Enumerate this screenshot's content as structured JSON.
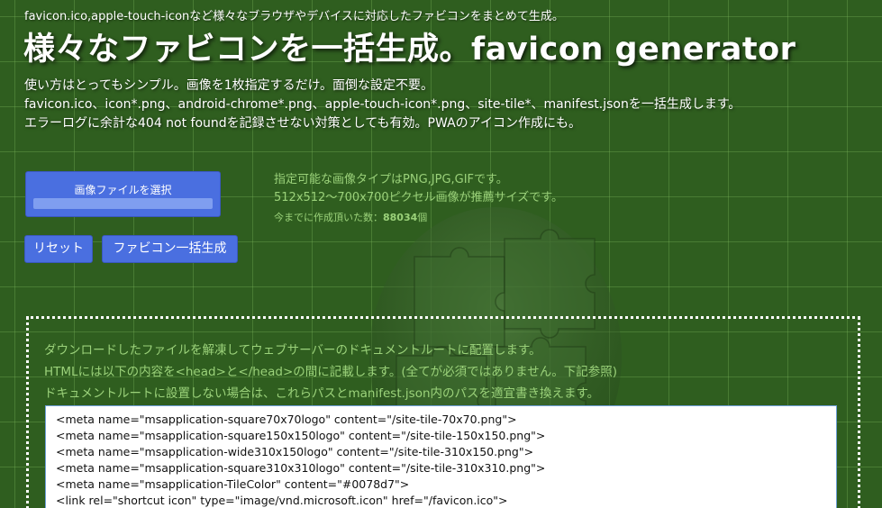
{
  "header": {
    "tagline": "favicon.ico,apple-touch-iconなど様々なブラウザやデバイスに対応したファビコンをまとめて生成。",
    "title": "様々なファビコンを一括生成。favicon generator"
  },
  "intro": {
    "lines": [
      "使い方はとってもシンプル。画像を1枚指定するだけ。面倒な設定不要。",
      "favicon.ico、icon*.png、android-chrome*.png、apple-touch-icon*.png、site-tile*、manifest.jsonを一括生成します。",
      "エラーログに余計な404 not foundを記録させない対策としても有効。PWAのアイコン作成にも。"
    ]
  },
  "controls": {
    "file_select_label": "画像ファイルを選択",
    "reset_label": "リセット",
    "generate_label": "ファビコン一括生成"
  },
  "info": {
    "line1": "指定可能な画像タイプはPNG,JPG,GIFです。",
    "line2": "512x512〜700x700ピクセル画像が推薦サイズです。",
    "count_label": "今までに作成頂いた数：",
    "count_value": "88034",
    "count_unit": "個"
  },
  "instructions": {
    "lines": [
      "ダウンロードしたファイルを解凍してウェブサーバーのドキュメントルートに配置します。",
      "HTMLには以下の内容を<head>と</head>の間に記載します。(全てが必須ではありません。下記参照)",
      "ドキュメントルートに設置しない場合は、これらパスとmanifest.json内のパスを適宜書き換えます。"
    ],
    "code_lines": [
      "<meta name=\"msapplication-square70x70logo\" content=\"/site-tile-70x70.png\">",
      "<meta name=\"msapplication-square150x150logo\" content=\"/site-tile-150x150.png\">",
      "<meta name=\"msapplication-wide310x150logo\" content=\"/site-tile-310x150.png\">",
      "<meta name=\"msapplication-square310x310logo\" content=\"/site-tile-310x310.png\">",
      "<meta name=\"msapplication-TileColor\" content=\"#0078d7\">",
      "<link rel=\"shortcut icon\" type=\"image/vnd.microsoft.icon\" href=\"/favicon.ico\">"
    ]
  },
  "colors": {
    "background": "#2f5e1f",
    "accent_text": "#9bd27a",
    "button": "#4a6fe0"
  },
  "icons": {
    "background_art": "puzzle-globe-icon"
  }
}
